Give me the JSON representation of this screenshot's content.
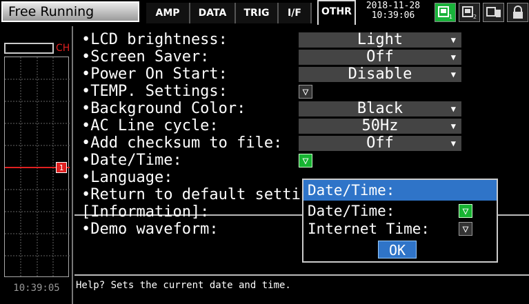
{
  "header": {
    "mode": "Free Running",
    "tabs": [
      {
        "label": "AMP",
        "active": false
      },
      {
        "label": "DATA",
        "active": false
      },
      {
        "label": "TRIG",
        "active": false
      },
      {
        "label": "I/F",
        "active": false
      },
      {
        "label": "OTHR",
        "active": true
      }
    ],
    "date": "2018-11-28",
    "time": "10:39:06",
    "status_icons": [
      "memory-1-icon",
      "memory-2-icon",
      "device-icon",
      "lock-icon"
    ]
  },
  "left": {
    "channel_label": "CH",
    "marker_label": "1",
    "clock": "10:39:05"
  },
  "settings": {
    "items": [
      {
        "label": "•LCD brightness:",
        "value": "Light"
      },
      {
        "label": "•Screen Saver:",
        "value": "Off"
      },
      {
        "label": "•Power On Start:",
        "value": "Disable"
      },
      {
        "label": "•TEMP. Settings:",
        "value": ""
      },
      {
        "label": "•Background Color:",
        "value": "Black"
      },
      {
        "label": "•AC Line cycle:",
        "value": "50Hz"
      },
      {
        "label": "•Add checksum to file:",
        "value": "Off"
      },
      {
        "label": "•Date/Time:",
        "value": ""
      },
      {
        "label": "•Language:",
        "value": ""
      },
      {
        "label": "•Return to default settings",
        "value": ""
      },
      {
        "label": "[Information]:",
        "value": ""
      },
      {
        "label": "•Demo waveform:",
        "value": ""
      }
    ]
  },
  "popup": {
    "title": "Date/Time:",
    "rows": [
      {
        "label": "Date/Time:"
      },
      {
        "label": "Internet Time:"
      }
    ],
    "ok_label": "OK"
  },
  "help": {
    "text": "Help?  Sets the current date and time."
  },
  "colors": {
    "accent_blue": "#2f74c8",
    "green_active": "#17b332",
    "channel_red": "#e02020"
  }
}
